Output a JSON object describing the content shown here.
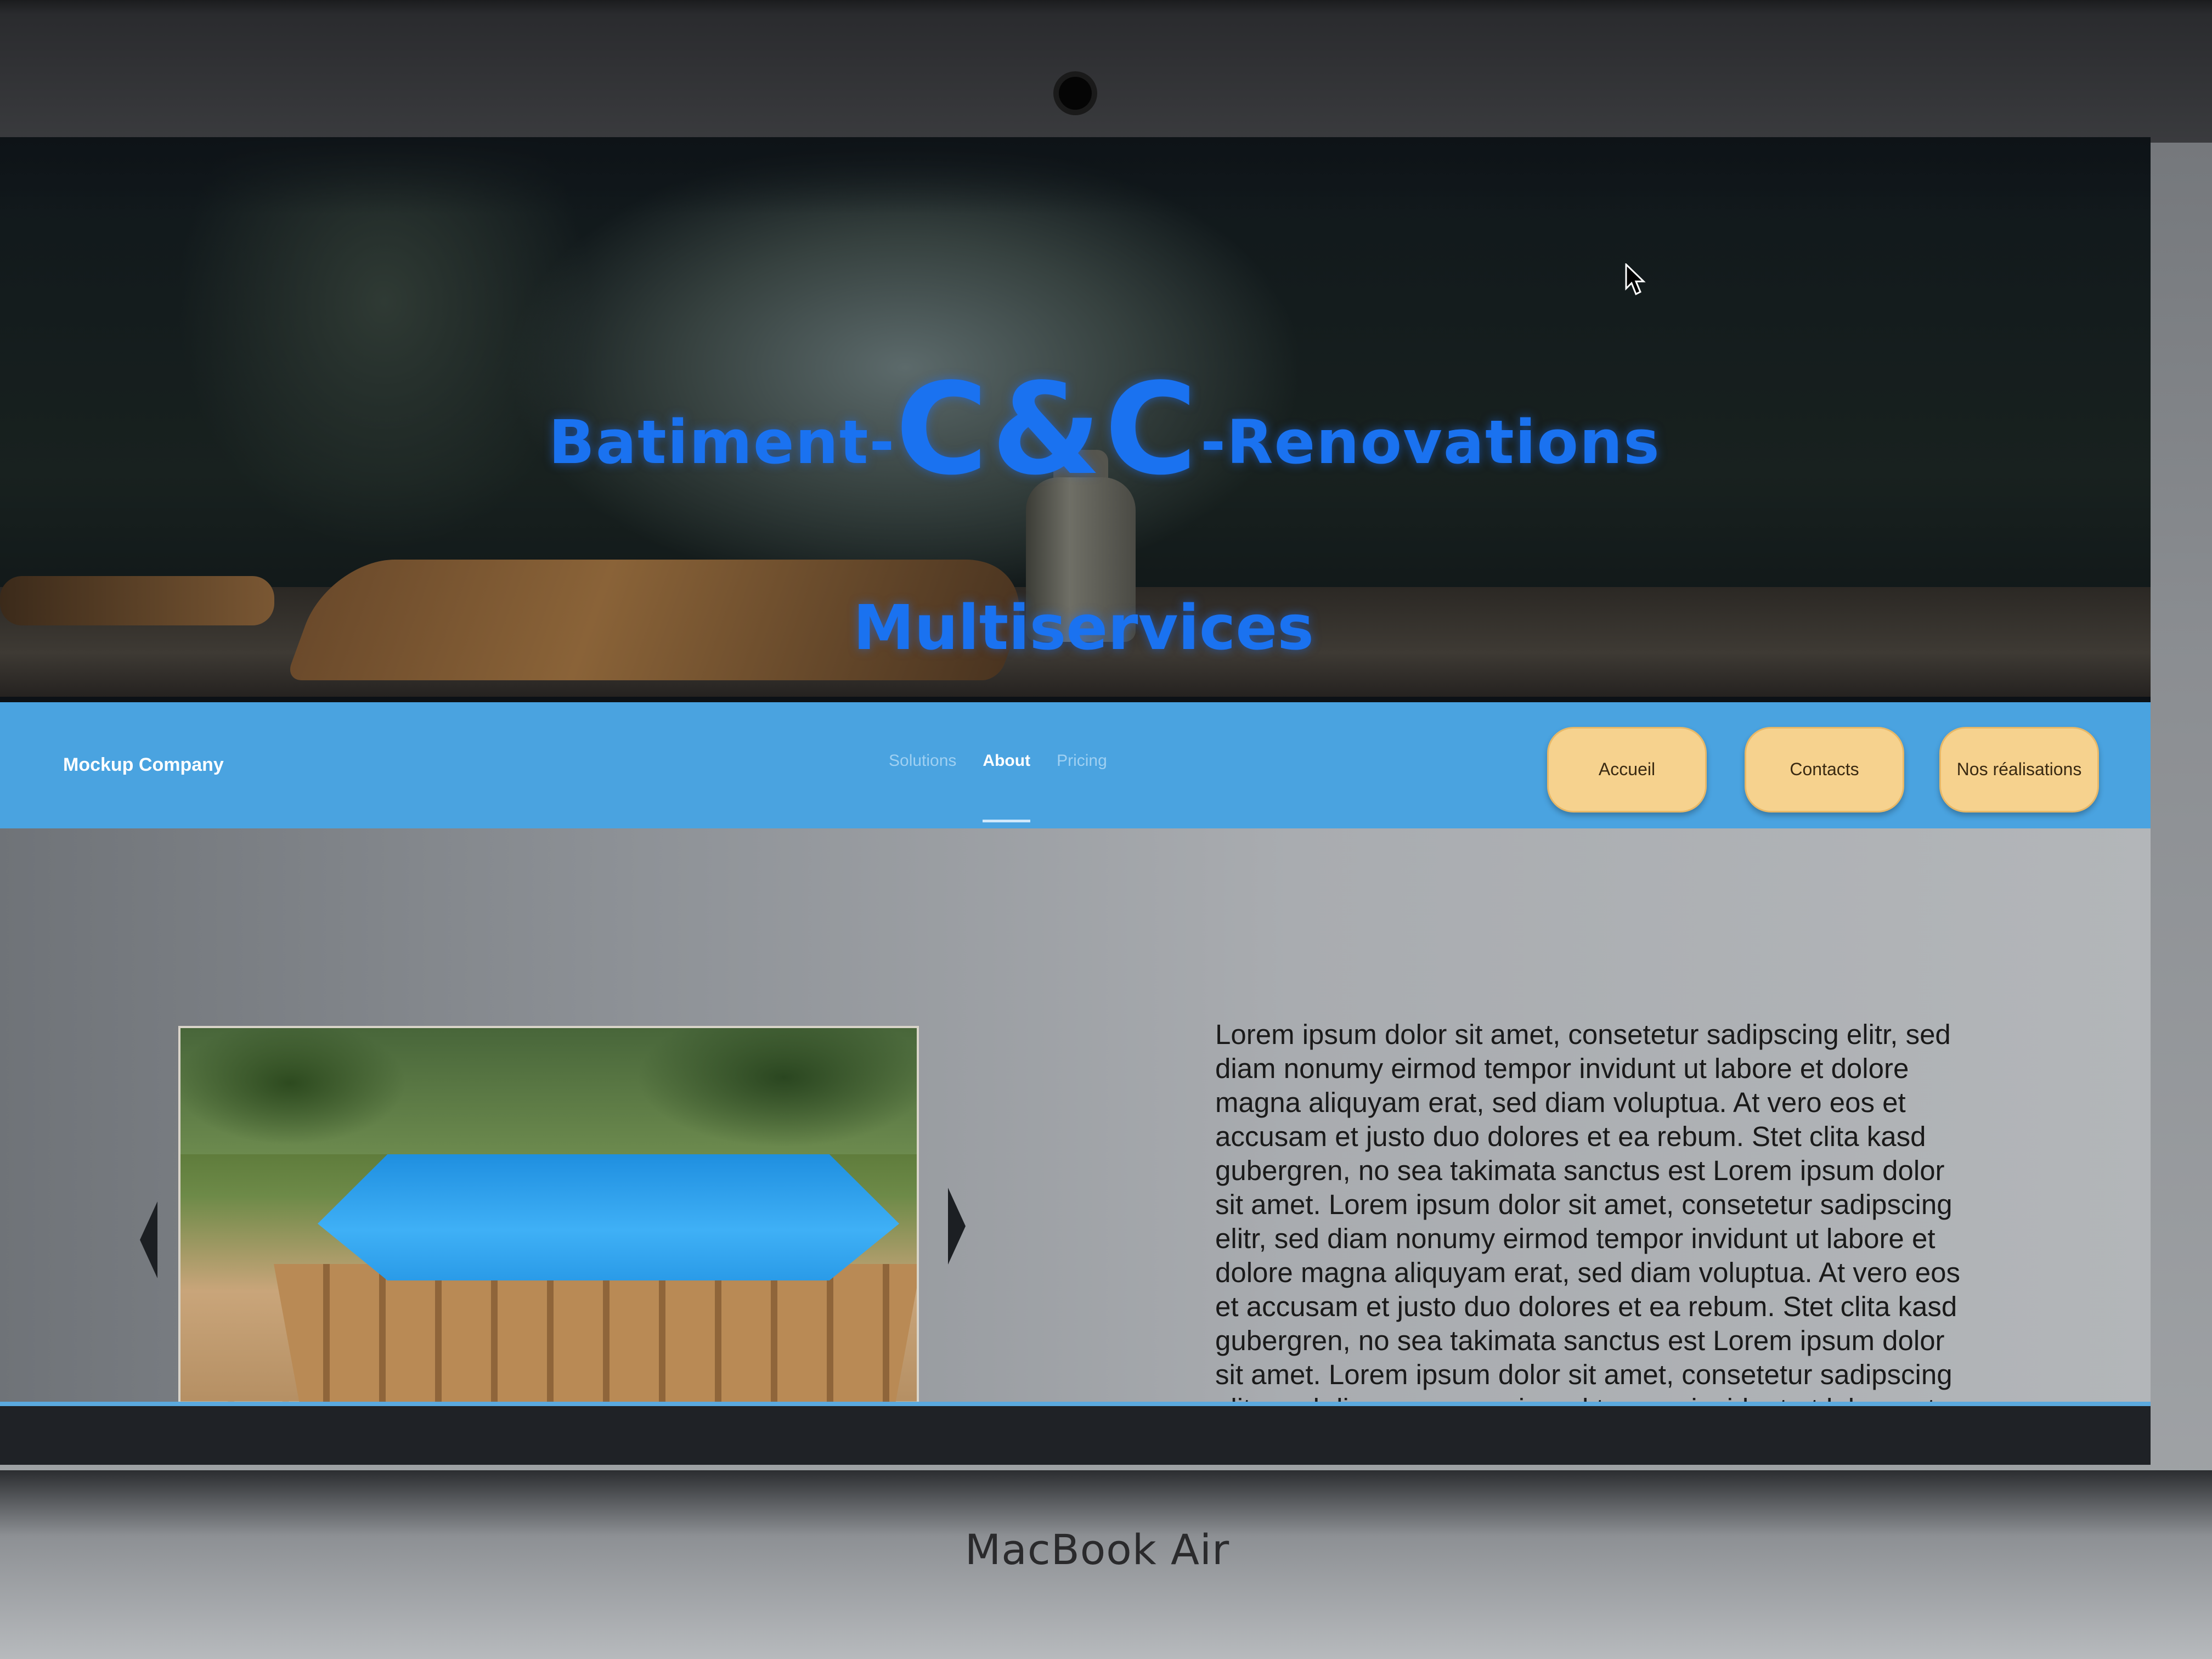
{
  "hero": {
    "title_left": "Batiment-",
    "title_center": "C&C",
    "title_right": "-Renovations",
    "subtitle": "Multiservices",
    "title_color": "#1a72f0"
  },
  "navbar": {
    "brand": "Mockup Company",
    "links": [
      {
        "label": "Solutions",
        "active": false
      },
      {
        "label": "About",
        "active": true
      },
      {
        "label": "Pricing",
        "active": false
      }
    ],
    "buttons": [
      "Accueil",
      "Contacts",
      "Nos réalisations"
    ],
    "background_color": "#4aa3e0",
    "button_color": "#f6d28e"
  },
  "content": {
    "paragraph": "Lorem ipsum dolor sit amet, consetetur sadipscing elitr, sed diam nonumy eirmod tempor invidunt ut labore et dolore magna aliquyam erat, sed diam voluptua. At vero eos et accusam et justo duo dolores et ea rebum. Stet clita kasd gubergren, no sea takimata sanctus est Lorem ipsum dolor sit amet. Lorem ipsum dolor sit amet, consetetur sadipscing elitr, sed diam nonumy eirmod tempor invidunt ut labore et dolore magna aliquyam erat, sed diam voluptua. At vero eos et accusam et justo duo dolores et ea rebum. Stet clita kasd gubergren, no sea takimata sanctus est Lorem ipsum dolor sit amet. Lorem ipsum dolor sit amet, consetetur sadipscing elitr, sed diam nonumy eirmod tempor invidunt ut labore et",
    "slider_prev_icon": "chevron-left-icon",
    "slider_next_icon": "chevron-right-icon"
  },
  "device": {
    "label": "MacBook Air"
  }
}
